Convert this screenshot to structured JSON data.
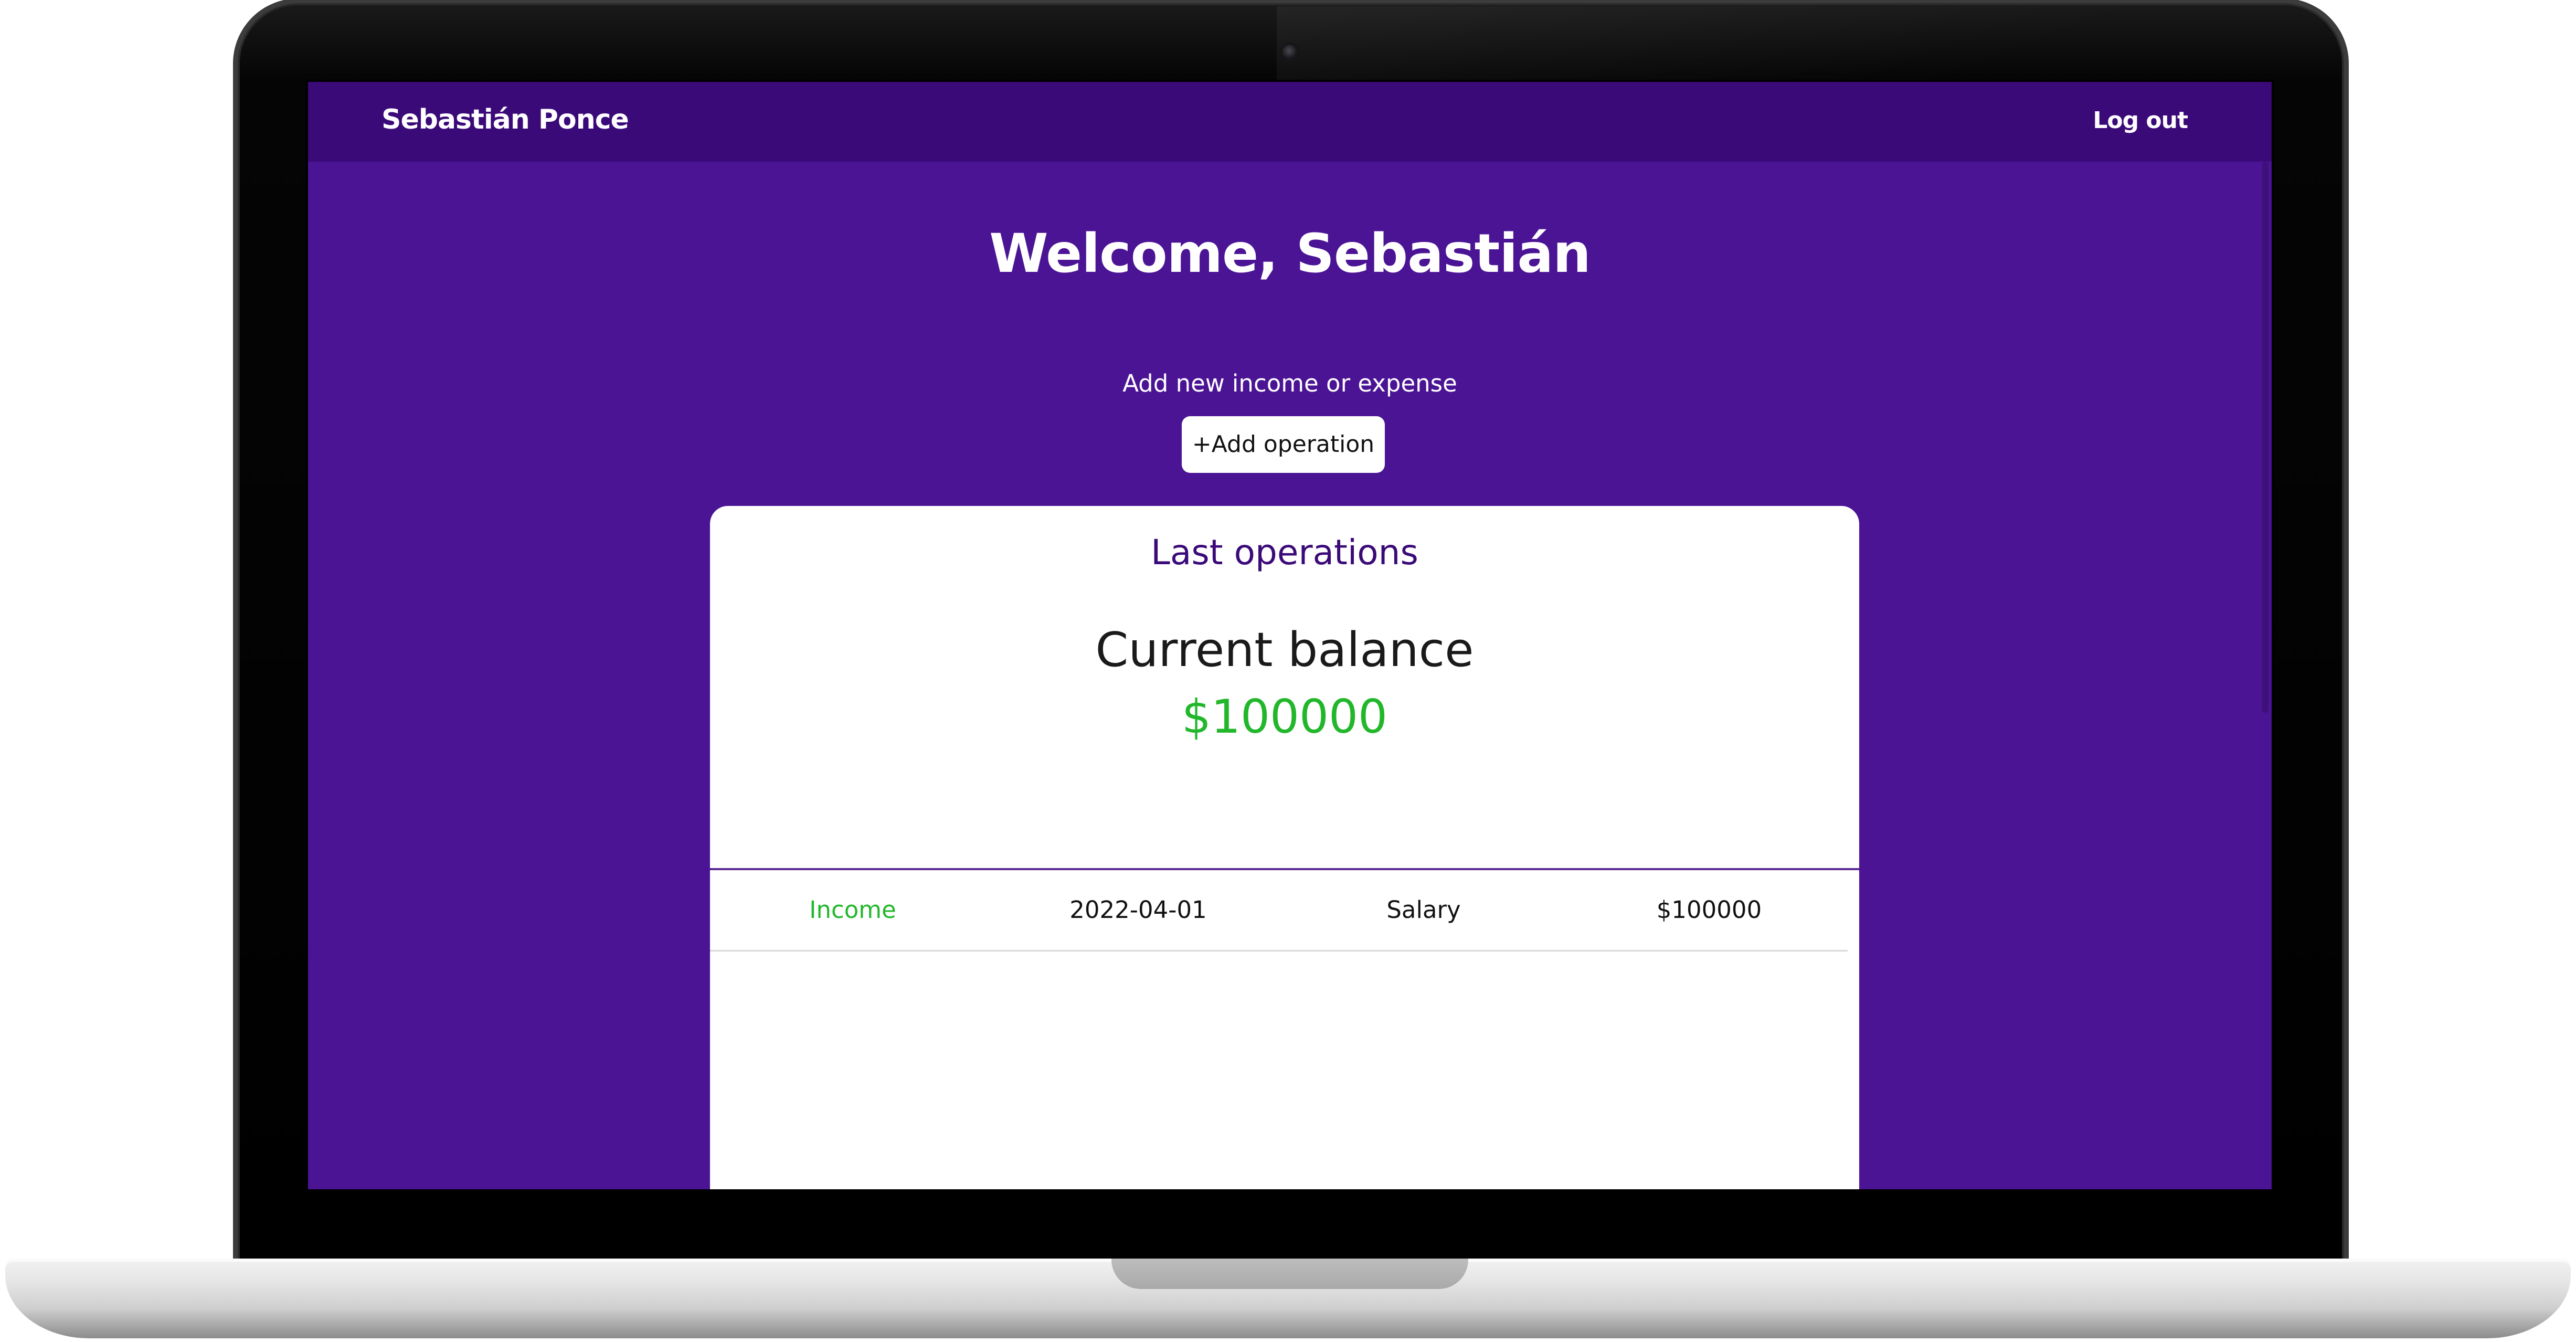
{
  "navbar": {
    "brand": "Sebastián Ponce",
    "logout_label": "Log out"
  },
  "main": {
    "welcome": "Welcome, Sebastián",
    "add_hint": "Add new income or expense",
    "add_button_label": "+Add operation"
  },
  "card": {
    "title": "Last operations",
    "balance_label": "Current balance",
    "balance_value": "$100000",
    "operations": [
      {
        "type": "Income",
        "date": "2022-04-01",
        "concept": "Salary",
        "amount": "$100000"
      }
    ]
  },
  "colors": {
    "navbar": "#3b0a79",
    "page_background": "#4b1495",
    "card_title": "#3b0a79",
    "income": "#22b72b",
    "divider": "#5a2a92"
  },
  "icons": [
    "webcam-icon"
  ]
}
